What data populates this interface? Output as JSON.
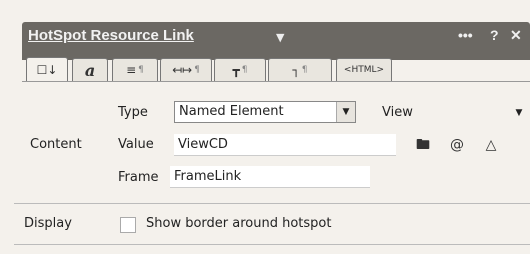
{
  "window": {
    "title": "HotSpot Resource Link",
    "menu_glyph": "▼",
    "minimize": "•••",
    "help": "?",
    "close": "✕"
  },
  "tabs": [
    {
      "glyph": "☐↓",
      "pilcrow": ""
    },
    {
      "glyph": "a",
      "pilcrow": ""
    },
    {
      "glyph": "≡",
      "pilcrow": "¶"
    },
    {
      "glyph": "↤↦",
      "pilcrow": "¶"
    },
    {
      "glyph": "┳",
      "pilcrow": "¶"
    },
    {
      "glyph": "┐",
      "pilcrow": "¶"
    },
    {
      "glyph": "<HTML>",
      "pilcrow": ""
    }
  ],
  "content": {
    "section_label": "Content",
    "type_label": "Type",
    "type_value": "Named Element",
    "view_value": "View",
    "value_label": "Value",
    "value_text": "ViewCD",
    "frame_label": "Frame",
    "frame_text": "FrameLink"
  },
  "display": {
    "section_label": "Display",
    "checkbox_label": "Show border around hotspot",
    "checked": false
  }
}
